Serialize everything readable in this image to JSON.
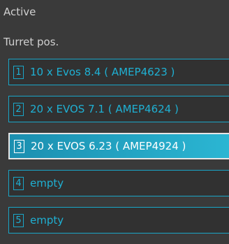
{
  "labels": {
    "active": "Active",
    "turret_pos": "Turret pos."
  },
  "turrets": [
    {
      "slot": "1",
      "label": "10 x Evos 8.4 ( AMEP4623 )",
      "selected": false
    },
    {
      "slot": "2",
      "label": "20 x EVOS 7.1 ( AMEP4624 )",
      "selected": false
    },
    {
      "slot": "3",
      "label": "20 x EVOS 6.23 ( AMEP4924 )",
      "selected": true
    },
    {
      "slot": "4",
      "label": "empty",
      "selected": false
    },
    {
      "slot": "5",
      "label": "empty",
      "selected": false
    }
  ],
  "colors": {
    "background": "#3a3a3a",
    "accent": "#1aa6c8",
    "selected_fill": "#2bb6d3"
  }
}
